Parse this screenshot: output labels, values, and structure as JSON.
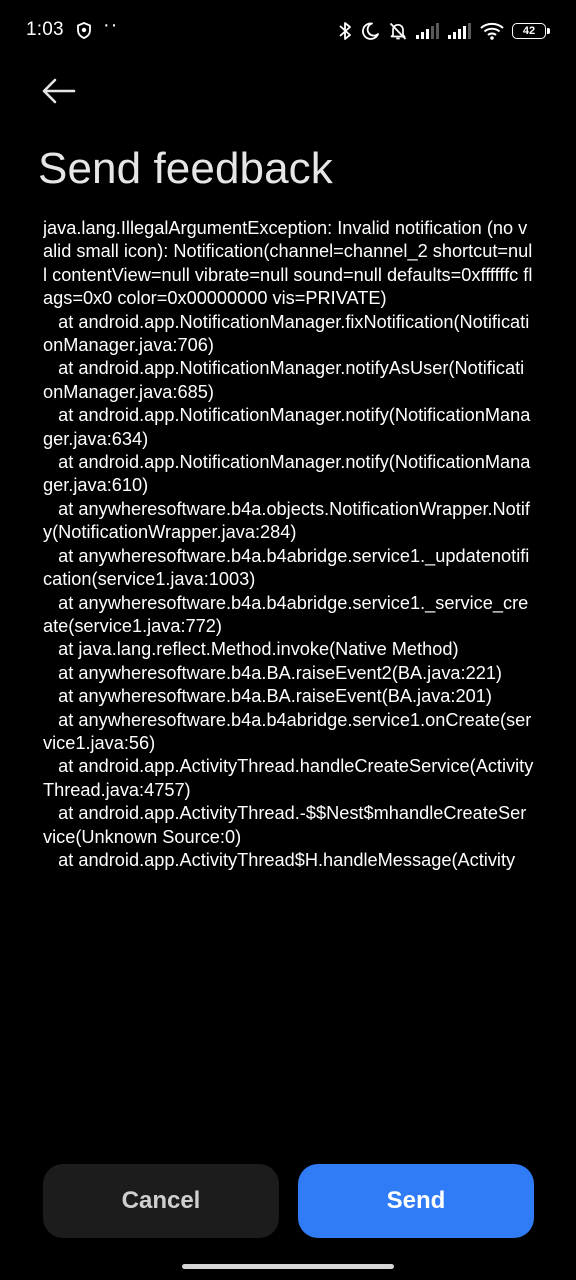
{
  "status_bar": {
    "time": "1:03",
    "notification_dots": "··",
    "battery_level": "42",
    "icons": [
      "shield-icon",
      "bluetooth-icon",
      "moon-icon",
      "bell-off-icon",
      "signal-icon",
      "signal-icon",
      "wifi-icon",
      "battery-icon"
    ]
  },
  "header": {
    "back_icon": "arrow-left-icon",
    "title": "Send feedback"
  },
  "log": {
    "text": "java.lang.IllegalArgumentException: Invalid notification (no valid small icon): Notification(channel=channel_2 shortcut=null contentView=null vibrate=null sound=null defaults=0xffffffc flags=0x0 color=0x00000000 vis=PRIVATE)\n   at android.app.NotificationManager.fixNotification(NotificationManager.java:706)\n   at android.app.NotificationManager.notifyAsUser(NotificationManager.java:685)\n   at android.app.NotificationManager.notify(NotificationManager.java:634)\n   at android.app.NotificationManager.notify(NotificationManager.java:610)\n   at anywheresoftware.b4a.objects.NotificationWrapper.Notify(NotificationWrapper.java:284)\n   at anywheresoftware.b4a.b4abridge.service1._updatenotification(service1.java:1003)\n   at anywheresoftware.b4a.b4abridge.service1._service_create(service1.java:772)\n   at java.lang.reflect.Method.invoke(Native Method)\n   at anywheresoftware.b4a.BA.raiseEvent2(BA.java:221)\n   at anywheresoftware.b4a.BA.raiseEvent(BA.java:201)\n   at anywheresoftware.b4a.b4abridge.service1.onCreate(service1.java:56)\n   at android.app.ActivityThread.handleCreateService(ActivityThread.java:4757)\n   at android.app.ActivityThread.-$$Nest$mhandleCreateService(Unknown Source:0)\n   at android.app.ActivityThread$H.handleMessage(Activity"
  },
  "actions": {
    "cancel_label": "Cancel",
    "send_label": "Send"
  },
  "colors": {
    "background": "#000000",
    "send_button": "#2f7cf6",
    "cancel_button": "#1c1c1c"
  }
}
